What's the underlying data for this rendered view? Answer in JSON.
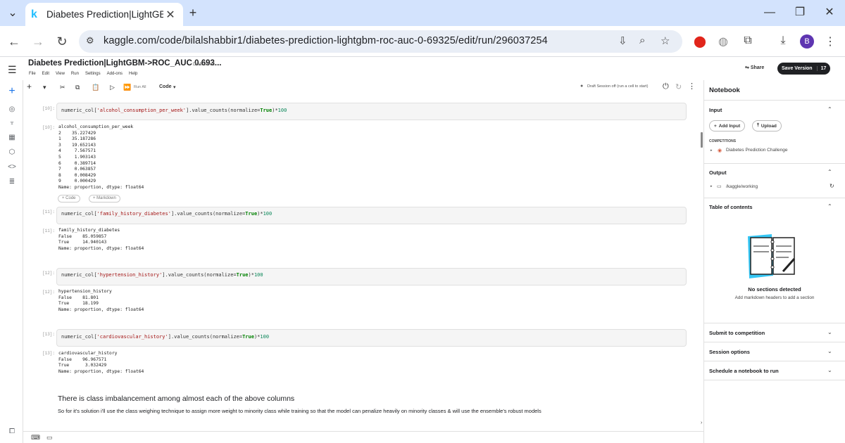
{
  "browser": {
    "tab_title": "Diabetes Prediction|LightGBM-",
    "url": "kaggle.com/code/bilalshabbir1/diabetes-prediction-lightgbm-roc-auc-0-69325/edit/run/296037254",
    "avatar": "B"
  },
  "notebook": {
    "title": "Diabetes Prediction|LightGBM->ROC_AUC 0.693...",
    "draft_status": "Draft saved",
    "menu": [
      "File",
      "Edit",
      "View",
      "Run",
      "Settings",
      "Add-ons",
      "Help"
    ],
    "share_label": "Share",
    "save_version_label": "Save Version",
    "version_count": "17",
    "toolbar": {
      "run_all": "Run All",
      "cell_type": "Code",
      "session_status": "Draft Session off (run a cell to start)"
    }
  },
  "cells": [
    {
      "in_num": "[10]:",
      "out_num": "[10]:",
      "code_pre": "numeric_col[",
      "code_str": "'alcohol_consumption_per_week'",
      "code_mid": "].value_counts(normalize=",
      "code_kw": "True",
      "code_post": ")*",
      "code_num": "100",
      "output": "alcohol_consumption_per_week\n2    35.227429\n1    35.187286\n3    19.652143\n4     7.567571\n5     1.903143\n6     0.389714\n7     0.063857\n8     0.008429\n9     0.000429\nName: proportion, dtype: float64"
    },
    {
      "in_num": "[11]:",
      "out_num": "[11]:",
      "code_pre": "numeric_col[",
      "code_str": "'family_history_diabetes'",
      "code_mid": "].value_counts(normalize=",
      "code_kw": "True",
      "code_post": ")*",
      "code_num": "100",
      "output": "family_history_diabetes\nFalse    85.059857\nTrue     14.940143\nName: proportion, dtype: float64"
    },
    {
      "in_num": "[12]:",
      "out_num": "[12]:",
      "code_pre": "numeric_col[",
      "code_str": "'hypertension_history'",
      "code_mid": "].value_counts(normalize=",
      "code_kw": "True",
      "code_post": ")*",
      "code_num": "100",
      "output": "hypertension_history\nFalse    81.801\nTrue     18.199\nName: proportion, dtype: float64"
    },
    {
      "in_num": "[13]:",
      "out_num": "[13]:",
      "code_pre": "numeric_col[",
      "code_str": "'cardiovascular_history'",
      "code_mid": "].value_counts(normalize=",
      "code_kw": "True",
      "code_post": ")*",
      "code_num": "100",
      "output": "cardiovascular_history\nFalse    96.967571\nTrue      3.032429\nName: proportion, dtype: float64"
    }
  ],
  "add_cell": {
    "code": "+ Code",
    "markdown": "+ Markdown"
  },
  "markdown": {
    "heading": "There is class imbalancement among almost each of the above columns",
    "text": "So for it's solution i'll use the class weighing technique to assign more weight to minority class while training so that the model can penalize heavily on minority classes & will use the ensemble's robust models"
  },
  "sidebar": {
    "title": "Notebook",
    "input": {
      "label": "Input",
      "add_input": "Add Input",
      "upload": "Upload",
      "competitions_label": "COMPETITIONS",
      "competition": "Diabetes Prediction Challenge"
    },
    "output": {
      "label": "Output",
      "path": "/kaggle/working"
    },
    "toc": {
      "label": "Table of contents",
      "empty_title": "No sections detected",
      "empty_hint": "Add markdown headers to add a section"
    },
    "collapsed": [
      "Submit to competition",
      "Session options",
      "Schedule a notebook to run"
    ]
  }
}
